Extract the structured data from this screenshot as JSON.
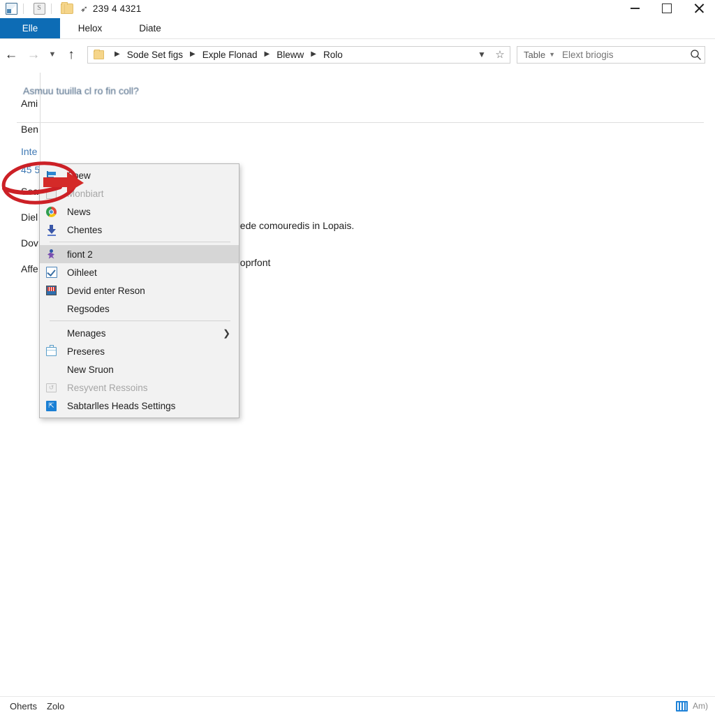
{
  "window": {
    "title": "239 4 4321",
    "icons": [
      "window-icon",
      "app-icon",
      "folder-icon",
      "pin-icon"
    ],
    "controls": {
      "minimize": "minimize-icon",
      "maximize": "maximize-icon",
      "close": "close-icon"
    },
    "sub_controls": {
      "minimize": "minimize-icon",
      "help": "help-icon"
    }
  },
  "ribbon": {
    "tabs": [
      {
        "label": "Elle",
        "active": true
      },
      {
        "label": "Helox",
        "active": false
      },
      {
        "label": "Diate",
        "active": false
      }
    ]
  },
  "nav": {
    "back": "back-arrow-icon",
    "forward": "forward-arrow-icon",
    "recent": "chevron-down-icon",
    "up": "up-arrow-icon",
    "breadcrumbs": [
      "Sode Set figs",
      "Exple Flonad",
      "Bleww",
      "Rolo"
    ],
    "dropdown": "chevron-down-icon",
    "favorite": "star-icon"
  },
  "search": {
    "scope": "Table",
    "scope_caret": "chevron-down-icon",
    "placeholder": "Elext briogis",
    "value": "",
    "icon": "search-icon"
  },
  "document": {
    "heading": "Asmuu tuuilla cl ro fin coll?",
    "left_rows": [
      {
        "text": "Ami",
        "link": false
      },
      {
        "text": "Ben",
        "link": false
      },
      {
        "text": "Inte",
        "link": true
      },
      {
        "text": "45 5",
        "link": true
      },
      {
        "text": "Seat",
        "link": false
      },
      {
        "text": "Diel",
        "link": false
      },
      {
        "text": "Dov",
        "link": false
      },
      {
        "text": "Affe",
        "link": false
      }
    ],
    "body_lines": [
      "eede comouredis in Lopais.",
      "doprfont"
    ]
  },
  "context_menu": {
    "items": [
      {
        "label": "Soew",
        "icon": "flag-icon",
        "type": "item",
        "state": "normal"
      },
      {
        "label": "Monbiart",
        "icon": "grey-square-icon",
        "type": "item",
        "state": "disabled"
      },
      {
        "label": "News",
        "icon": "chrome-icon",
        "type": "item",
        "state": "normal"
      },
      {
        "label": "Chentes",
        "icon": "download-icon",
        "type": "item",
        "state": "normal"
      },
      {
        "type": "separator"
      },
      {
        "label": "fiont 2",
        "icon": "person-icon",
        "type": "item",
        "state": "highlight"
      },
      {
        "label": "Oihleet",
        "icon": "checkbox-icon",
        "type": "item",
        "state": "normal"
      },
      {
        "label": "Devid enter Reson",
        "icon": "monitor-icon",
        "type": "item",
        "state": "normal"
      },
      {
        "label": "Regsodes",
        "icon": "none",
        "type": "item",
        "state": "normal"
      },
      {
        "type": "separator"
      },
      {
        "label": "Menages",
        "icon": "none",
        "type": "submenu",
        "state": "normal",
        "arrow": "chevron-right-icon"
      },
      {
        "label": "Preseres",
        "icon": "case-icon",
        "type": "item",
        "state": "normal"
      },
      {
        "label": "New Sruon",
        "icon": "none",
        "type": "item",
        "state": "normal"
      },
      {
        "label": "Resyvent Ressoins",
        "icon": "restore-icon",
        "type": "item",
        "state": "disabled"
      },
      {
        "label": "Sabtarlles Heads Settings",
        "icon": "blue-square-icon",
        "type": "item",
        "state": "normal"
      }
    ]
  },
  "annotation": {
    "shape": "red-ellipse-with-arrow",
    "color": "#cc2026"
  },
  "statusbar": {
    "left_items": [
      "Oherts",
      "Zolo"
    ],
    "view_icon": "view-mode-icon",
    "right_text": "Am)"
  },
  "colors": {
    "accent_blue": "#0d6cb5",
    "link_blue": "#3f79b4",
    "menu_bg": "#f2f2f2",
    "highlight": "#d6d6d6",
    "annotation_red": "#cc2026"
  }
}
